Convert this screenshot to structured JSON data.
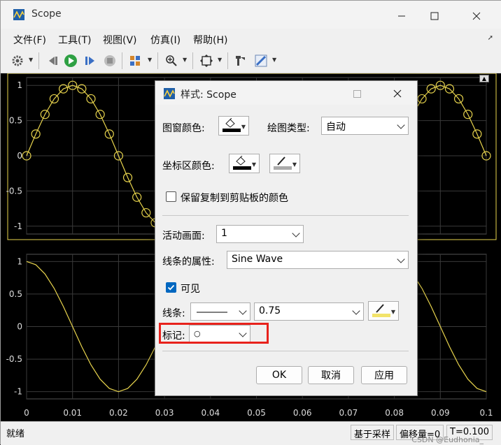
{
  "window": {
    "title": "Scope",
    "menu": [
      "文件(F)",
      "工具(T)",
      "视图(V)",
      "仿真(I)",
      "帮助(H)"
    ]
  },
  "status": {
    "ready": "就绪",
    "mode": "基于采样",
    "offset": "偏移量=0",
    "time": "T=0.100"
  },
  "watermark": "CSDN @Eudhonia_",
  "plot": {
    "line_color": "#e8d44d",
    "bg_color": "#000000",
    "grid_color": "#3a3a3a",
    "y_ticks": [
      "1",
      "0.5",
      "0",
      "-0.5",
      "-1"
    ],
    "x_ticks": [
      "0",
      "0.01",
      "0.02",
      "0.03",
      "0.04",
      "0.05",
      "0.06",
      "0.07",
      "0.08",
      "0.09",
      "0.1"
    ]
  },
  "dialog": {
    "title": "样式: Scope",
    "figure_color_label": "图窗颜色:",
    "plot_type_label": "绘图类型:",
    "plot_type_value": "自动",
    "axes_color_label": "坐标区颜色:",
    "keep_colors_label": "保留复制到剪贴板的颜色",
    "active_display_label": "活动画面:",
    "active_display_value": "1",
    "line_props_label": "线条的属性:",
    "line_props_value": "Sine Wave",
    "visible_label": "可见",
    "line_label": "线条:",
    "line_width_value": "0.75",
    "marker_label": "标记:",
    "marker_value": "○",
    "ok": "OK",
    "cancel": "取消",
    "apply": "应用"
  }
}
